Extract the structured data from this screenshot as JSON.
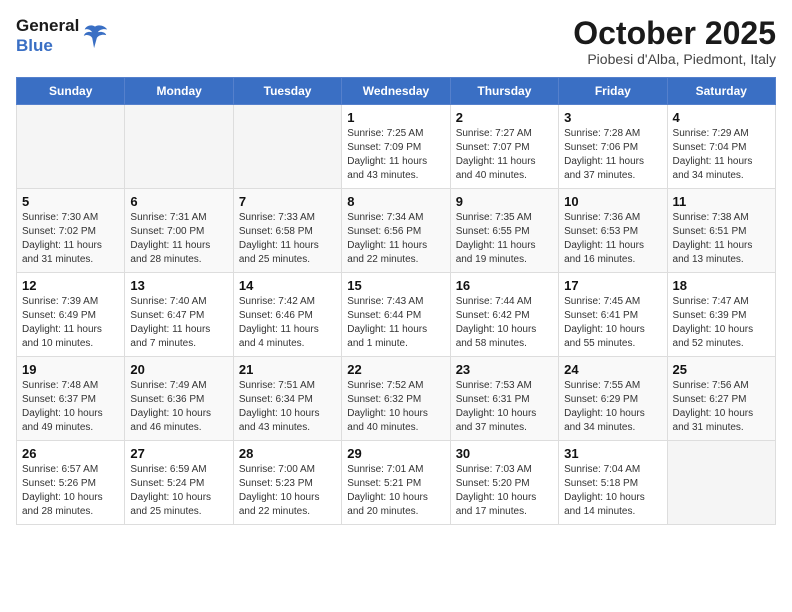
{
  "header": {
    "logo_general": "General",
    "logo_blue": "Blue",
    "month_title": "October 2025",
    "subtitle": "Piobesi d'Alba, Piedmont, Italy"
  },
  "days_of_week": [
    "Sunday",
    "Monday",
    "Tuesday",
    "Wednesday",
    "Thursday",
    "Friday",
    "Saturday"
  ],
  "weeks": [
    [
      {
        "day": "",
        "info": ""
      },
      {
        "day": "",
        "info": ""
      },
      {
        "day": "",
        "info": ""
      },
      {
        "day": "1",
        "info": "Sunrise: 7:25 AM\nSunset: 7:09 PM\nDaylight: 11 hours and 43 minutes."
      },
      {
        "day": "2",
        "info": "Sunrise: 7:27 AM\nSunset: 7:07 PM\nDaylight: 11 hours and 40 minutes."
      },
      {
        "day": "3",
        "info": "Sunrise: 7:28 AM\nSunset: 7:06 PM\nDaylight: 11 hours and 37 minutes."
      },
      {
        "day": "4",
        "info": "Sunrise: 7:29 AM\nSunset: 7:04 PM\nDaylight: 11 hours and 34 minutes."
      }
    ],
    [
      {
        "day": "5",
        "info": "Sunrise: 7:30 AM\nSunset: 7:02 PM\nDaylight: 11 hours and 31 minutes."
      },
      {
        "day": "6",
        "info": "Sunrise: 7:31 AM\nSunset: 7:00 PM\nDaylight: 11 hours and 28 minutes."
      },
      {
        "day": "7",
        "info": "Sunrise: 7:33 AM\nSunset: 6:58 PM\nDaylight: 11 hours and 25 minutes."
      },
      {
        "day": "8",
        "info": "Sunrise: 7:34 AM\nSunset: 6:56 PM\nDaylight: 11 hours and 22 minutes."
      },
      {
        "day": "9",
        "info": "Sunrise: 7:35 AM\nSunset: 6:55 PM\nDaylight: 11 hours and 19 minutes."
      },
      {
        "day": "10",
        "info": "Sunrise: 7:36 AM\nSunset: 6:53 PM\nDaylight: 11 hours and 16 minutes."
      },
      {
        "day": "11",
        "info": "Sunrise: 7:38 AM\nSunset: 6:51 PM\nDaylight: 11 hours and 13 minutes."
      }
    ],
    [
      {
        "day": "12",
        "info": "Sunrise: 7:39 AM\nSunset: 6:49 PM\nDaylight: 11 hours and 10 minutes."
      },
      {
        "day": "13",
        "info": "Sunrise: 7:40 AM\nSunset: 6:47 PM\nDaylight: 11 hours and 7 minutes."
      },
      {
        "day": "14",
        "info": "Sunrise: 7:42 AM\nSunset: 6:46 PM\nDaylight: 11 hours and 4 minutes."
      },
      {
        "day": "15",
        "info": "Sunrise: 7:43 AM\nSunset: 6:44 PM\nDaylight: 11 hours and 1 minute."
      },
      {
        "day": "16",
        "info": "Sunrise: 7:44 AM\nSunset: 6:42 PM\nDaylight: 10 hours and 58 minutes."
      },
      {
        "day": "17",
        "info": "Sunrise: 7:45 AM\nSunset: 6:41 PM\nDaylight: 10 hours and 55 minutes."
      },
      {
        "day": "18",
        "info": "Sunrise: 7:47 AM\nSunset: 6:39 PM\nDaylight: 10 hours and 52 minutes."
      }
    ],
    [
      {
        "day": "19",
        "info": "Sunrise: 7:48 AM\nSunset: 6:37 PM\nDaylight: 10 hours and 49 minutes."
      },
      {
        "day": "20",
        "info": "Sunrise: 7:49 AM\nSunset: 6:36 PM\nDaylight: 10 hours and 46 minutes."
      },
      {
        "day": "21",
        "info": "Sunrise: 7:51 AM\nSunset: 6:34 PM\nDaylight: 10 hours and 43 minutes."
      },
      {
        "day": "22",
        "info": "Sunrise: 7:52 AM\nSunset: 6:32 PM\nDaylight: 10 hours and 40 minutes."
      },
      {
        "day": "23",
        "info": "Sunrise: 7:53 AM\nSunset: 6:31 PM\nDaylight: 10 hours and 37 minutes."
      },
      {
        "day": "24",
        "info": "Sunrise: 7:55 AM\nSunset: 6:29 PM\nDaylight: 10 hours and 34 minutes."
      },
      {
        "day": "25",
        "info": "Sunrise: 7:56 AM\nSunset: 6:27 PM\nDaylight: 10 hours and 31 minutes."
      }
    ],
    [
      {
        "day": "26",
        "info": "Sunrise: 6:57 AM\nSunset: 5:26 PM\nDaylight: 10 hours and 28 minutes."
      },
      {
        "day": "27",
        "info": "Sunrise: 6:59 AM\nSunset: 5:24 PM\nDaylight: 10 hours and 25 minutes."
      },
      {
        "day": "28",
        "info": "Sunrise: 7:00 AM\nSunset: 5:23 PM\nDaylight: 10 hours and 22 minutes."
      },
      {
        "day": "29",
        "info": "Sunrise: 7:01 AM\nSunset: 5:21 PM\nDaylight: 10 hours and 20 minutes."
      },
      {
        "day": "30",
        "info": "Sunrise: 7:03 AM\nSunset: 5:20 PM\nDaylight: 10 hours and 17 minutes."
      },
      {
        "day": "31",
        "info": "Sunrise: 7:04 AM\nSunset: 5:18 PM\nDaylight: 10 hours and 14 minutes."
      },
      {
        "day": "",
        "info": ""
      }
    ]
  ]
}
